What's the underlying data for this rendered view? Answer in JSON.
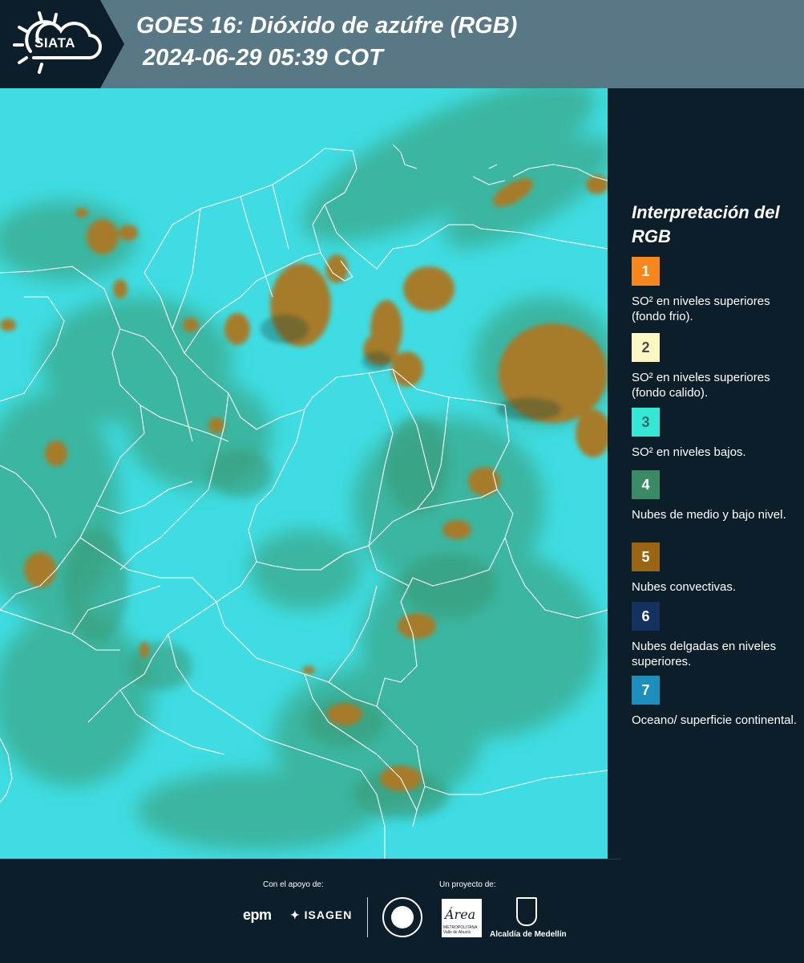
{
  "header": {
    "logo_text": "SIATA",
    "title": "GOES 16: Dióxido de azúfre (RGB)",
    "subtitle": "2024-06-29 05:39 COT"
  },
  "legend": {
    "title": "Interpretación del RGB",
    "items": [
      {
        "number": "1",
        "color": "#f6871f",
        "text_color": "#ffffff",
        "description": "SO² en niveles superiores (fondo frio)."
      },
      {
        "number": "2",
        "color": "#fdf7c3",
        "text_color": "#4a4a4a",
        "description": "SO² en niveles superiores (fondo calido)."
      },
      {
        "number": "3",
        "color": "#35e8d6",
        "text_color": "#2b6e66",
        "description": "SO² en niveles bajos."
      },
      {
        "number": "4",
        "color": "#3a8a65",
        "text_color": "#ffffff",
        "description": "Nubes de medio y bajo nivel."
      },
      {
        "number": "5",
        "color": "#9a6614",
        "text_color": "#ffffff",
        "description": "Nubes convectivas."
      },
      {
        "number": "6",
        "color": "#13325f",
        "text_color": "#ffffff",
        "description": "Nubes delgadas en niveles superiores."
      },
      {
        "number": "7",
        "color": "#1d8fbc",
        "text_color": "#ffffff",
        "description": "Oceano/ superficie continental."
      }
    ]
  },
  "footer": {
    "support_label": "Con el apoyo de:",
    "project_label": "Un proyecto de:",
    "epm": "epm",
    "isagen": "ISAGEN",
    "area_logo": "Área",
    "area_sub": "METROPOLITANA Valle de Aburrá",
    "alcaldia": "Alcaldía de Medellín"
  },
  "map_colors": {
    "background": "#3fdde3",
    "green_cloud": "#3ba88a",
    "convective": "#a07a2a",
    "border": "#ffffff"
  }
}
